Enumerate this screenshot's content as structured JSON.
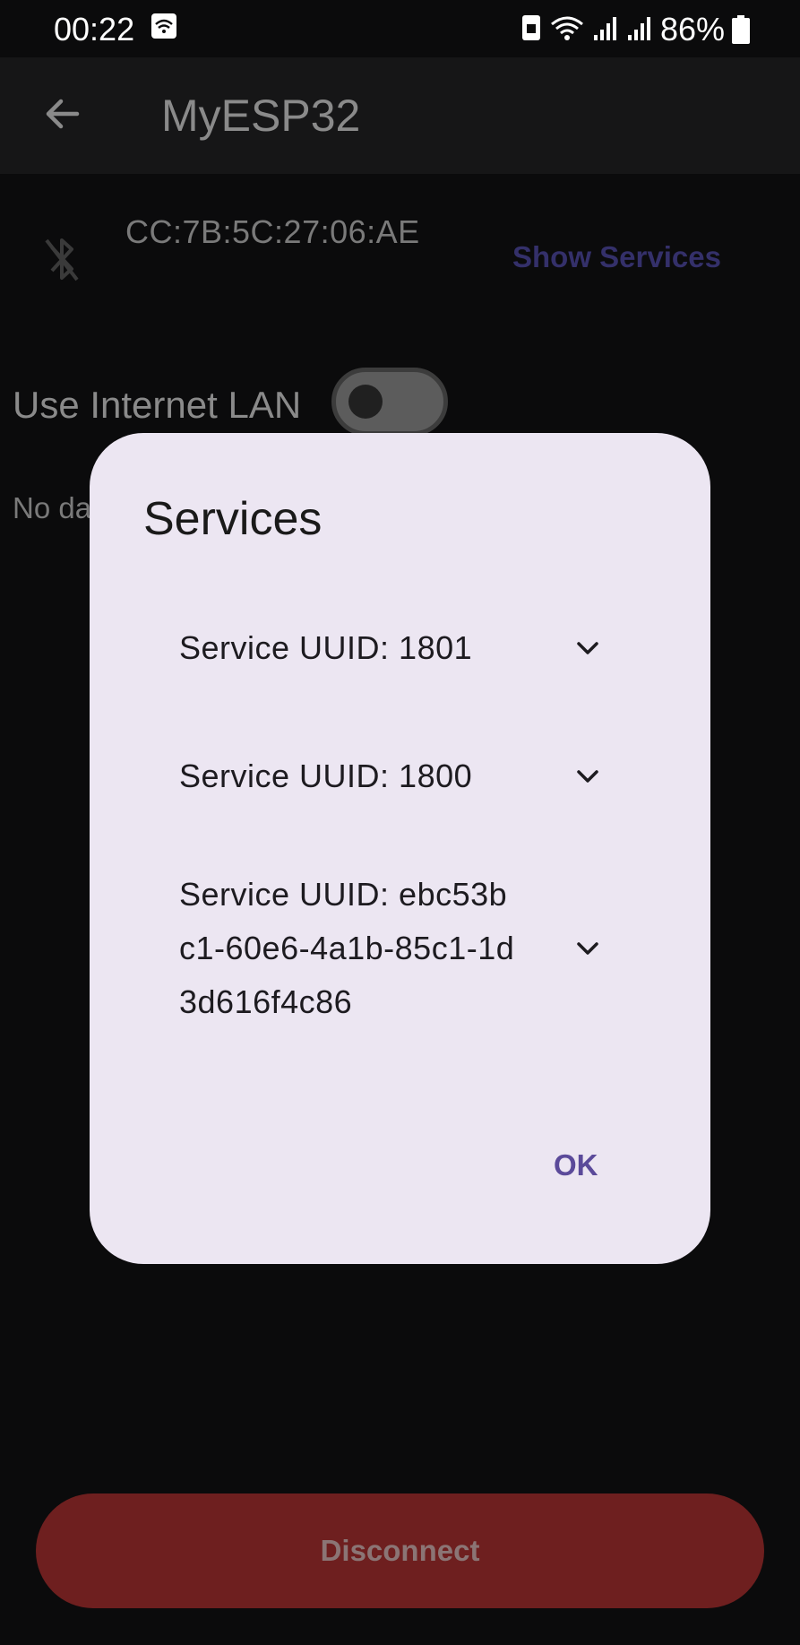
{
  "status_bar": {
    "time": "00:22",
    "battery": "86%"
  },
  "app_bar": {
    "title": "MyESP32"
  },
  "device": {
    "mac": "CC:7B:5C:27:06:AE",
    "show_services_label": "Show Services"
  },
  "lan": {
    "label": "Use Internet LAN",
    "enabled": false
  },
  "no_data_text": "No da",
  "dialog": {
    "title": "Services",
    "services": [
      {
        "label": "Service UUID: 1801"
      },
      {
        "label": "Service UUID: 1800"
      },
      {
        "label": "Service UUID: ebc53bc1-60e6-4a1b-85c1-1d3d616f4c86"
      }
    ],
    "ok_label": "OK"
  },
  "disconnect_label": "Disconnect",
  "colors": {
    "background": "#0b0b0c",
    "dialog": "#ece6f2",
    "accent": "#5b4a9a",
    "disconnect": "#6e1f1f"
  },
  "icons": {
    "back": "arrow-left-icon",
    "bluetooth": "bluetooth-disabled-icon",
    "chevron": "chevron-down-icon",
    "wifi": "wifi-icon",
    "battery": "battery-icon"
  }
}
